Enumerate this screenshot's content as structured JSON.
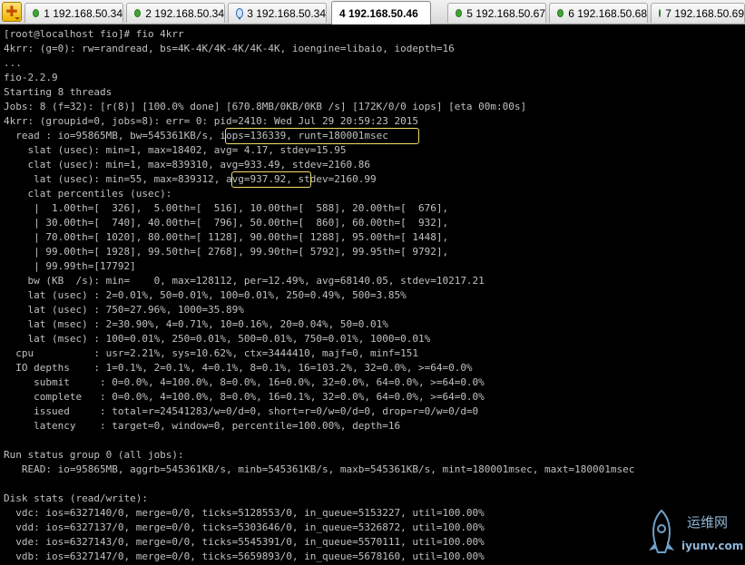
{
  "tabs": [
    {
      "label": "1 192.168.50.34",
      "icon": "green-dot-icon",
      "active": false
    },
    {
      "label": "2 192.168.50.34",
      "icon": "green-dot-icon",
      "active": false
    },
    {
      "label": "3 192.168.50.34",
      "icon": "chat-bubble-icon",
      "active": false
    },
    {
      "label": "4 192.168.50.46",
      "icon": "green-dot-icon",
      "active": true
    },
    {
      "label": "5 192.168.50.67",
      "icon": "green-dot-icon",
      "active": false
    },
    {
      "label": "6 192.168.50.68",
      "icon": "green-dot-icon",
      "active": false
    },
    {
      "label": "7 192.168.50.69",
      "icon": "green-dot-icon",
      "active": false
    }
  ],
  "tab_menu": {
    "icon": "plus-menu-icon"
  },
  "terminal": {
    "lines": [
      "[root@localhost fio]# fio 4krr",
      "4krr: (g=0): rw=randread, bs=4K-4K/4K-4K/4K-4K, ioengine=libaio, iodepth=16",
      "...",
      "fio-2.2.9",
      "Starting 8 threads",
      "Jobs: 8 (f=32): [r(8)] [100.0% done] [670.8MB/0KB/0KB /s] [172K/0/0 iops] [eta 00m:00s]",
      "4krr: (groupid=0, jobs=8): err= 0: pid=2410: Wed Jul 29 20:59:23 2015",
      "  read : io=95865MB, bw=545361KB/s, iops=136339, runt=180001msec",
      "    slat (usec): min=1, max=18402, avg= 4.17, stdev=15.95",
      "    clat (usec): min=1, max=839310, avg=933.49, stdev=2160.86",
      "     lat (usec): min=55, max=839312, avg=937.92, stdev=2160.99",
      "    clat percentiles (usec):",
      "     |  1.00th=[  326],  5.00th=[  516], 10.00th=[  588], 20.00th=[  676],",
      "     | 30.00th=[  740], 40.00th=[  796], 50.00th=[  860], 60.00th=[  932],",
      "     | 70.00th=[ 1020], 80.00th=[ 1128], 90.00th=[ 1288], 95.00th=[ 1448],",
      "     | 99.00th=[ 1928], 99.50th=[ 2768], 99.90th=[ 5792], 99.95th=[ 9792],",
      "     | 99.99th=[17792]",
      "    bw (KB  /s): min=    0, max=128112, per=12.49%, avg=68140.05, stdev=10217.21",
      "    lat (usec) : 2=0.01%, 50=0.01%, 100=0.01%, 250=0.49%, 500=3.85%",
      "    lat (usec) : 750=27.96%, 1000=35.89%",
      "    lat (msec) : 2=30.90%, 4=0.71%, 10=0.16%, 20=0.04%, 50=0.01%",
      "    lat (msec) : 100=0.01%, 250=0.01%, 500=0.01%, 750=0.01%, 1000=0.01%",
      "  cpu          : usr=2.21%, sys=10.62%, ctx=3444410, majf=0, minf=151",
      "  IO depths    : 1=0.1%, 2=0.1%, 4=0.1%, 8=0.1%, 16=103.2%, 32=0.0%, >=64=0.0%",
      "     submit     : 0=0.0%, 4=100.0%, 8=0.0%, 16=0.0%, 32=0.0%, 64=0.0%, >=64=0.0%",
      "     complete   : 0=0.0%, 4=100.0%, 8=0.0%, 16=0.1%, 32=0.0%, 64=0.0%, >=64=0.0%",
      "     issued     : total=r=24541283/w=0/d=0, short=r=0/w=0/d=0, drop=r=0/w=0/d=0",
      "     latency    : target=0, window=0, percentile=100.00%, depth=16",
      "",
      "Run status group 0 (all jobs):",
      "   READ: io=95865MB, aggrb=545361KB/s, minb=545361KB/s, maxb=545361KB/s, mint=180001msec, maxt=180001msec",
      "",
      "Disk stats (read/write):",
      "  vdc: ios=6327140/0, merge=0/0, ticks=5128553/0, in_queue=5153227, util=100.00%",
      "  vdd: ios=6327137/0, merge=0/0, ticks=5303646/0, in_queue=5326872, util=100.00%",
      "  vde: ios=6327143/0, merge=0/0, ticks=5545391/0, in_queue=5570111, util=100.00%",
      "  vdb: ios=6327147/0, merge=0/0, ticks=5659893/0, in_queue=5678160, util=100.00%"
    ],
    "text_color": "#c0c0c0",
    "background": "#000000",
    "highlight_color": "#f0dc6a"
  },
  "watermark": {
    "chinese": "运维网",
    "url": "iyunv.com",
    "icon": "rocket-logo-icon"
  }
}
